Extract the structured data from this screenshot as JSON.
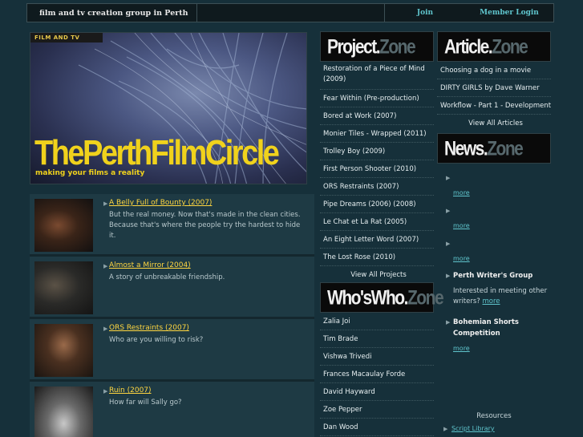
{
  "topbar": {
    "tagline": "film and tv creation group in Perth",
    "join": "Join",
    "login": "Member Login"
  },
  "banner": {
    "badge": "FILM AND TV",
    "title": "ThePerthFilmCircle",
    "subtitle": "making your films a reality"
  },
  "films": [
    {
      "title": "A Belly Full of Bounty (2007)",
      "desc": "But the real money. Now that's made in the clean cities. Because that's where the people try the hardest to hide it."
    },
    {
      "title": "Almost a Mirror (2004)",
      "desc": "A story of unbreakable friendship."
    },
    {
      "title": "ORS Restraints (2007)",
      "desc": "Who are you willing to risk?"
    },
    {
      "title": "Ruin (2007)",
      "desc": "How far will Sally go?"
    }
  ],
  "project_zone": {
    "word": "Project.",
    "zone": "Zone",
    "items": [
      "Restoration of a Piece of Mind (2009)",
      "Fear Within (Pre-production)",
      "Bored at Work (2007)",
      "Monier Tiles - Wrapped (2011)",
      "Trolley Boy (2009)",
      "First Person Shooter (2010)",
      "ORS Restraints (2007)",
      "Pipe Dreams (2006) (2008)",
      "Le Chat et La Rat (2005)",
      "An Eight Letter Word (2007)",
      "The Lost Rose (2010)"
    ],
    "view_all": "View All Projects"
  },
  "whos_zone": {
    "word": "Who'sWho.",
    "zone": "Zone",
    "items": [
      "Zalia Joi",
      "Tim Brade",
      "Vishwa Trivedi",
      "Frances Macaulay Forde",
      "David Hayward",
      "Zoe Pepper",
      "Dan Wood"
    ]
  },
  "article_zone": {
    "word": "Article.",
    "zone": "Zone",
    "items": [
      "Choosing a dog in a movie",
      "DIRTY GIRLS by Dave Warner",
      "Workflow - Part 1 - Development"
    ],
    "view_all": "View All Articles"
  },
  "news_zone": {
    "word": "News.",
    "zone": "Zone",
    "more": "more",
    "group_title": "Perth Writer's Group",
    "group_text": "Interested in meeting other writers?",
    "competition_title": "Bohemian Shorts Competition",
    "resources": "Resources",
    "script_library": "Script Library"
  },
  "colors": {
    "background": "#16303a",
    "accent_yellow": "#ffd640",
    "link_teal": "#5fc4cc"
  }
}
